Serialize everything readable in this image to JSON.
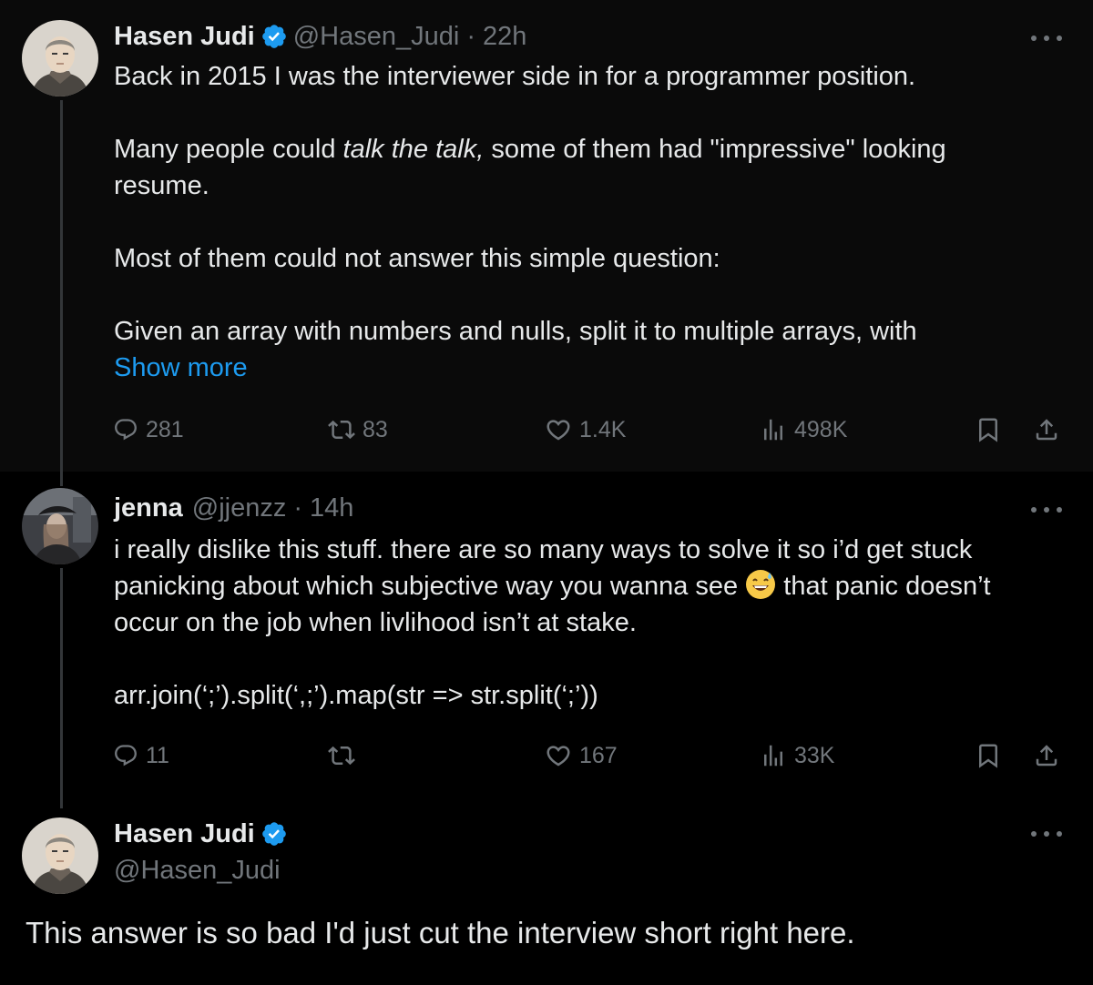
{
  "colors": {
    "background": "#000000",
    "text": "#e7e9ea",
    "muted": "#71767b",
    "link": "#1d9bf0",
    "verified": "#1d9bf0"
  },
  "tweets": [
    {
      "author": "Hasen Judi",
      "handle": "@Hasen_Judi",
      "separator": "·",
      "time": "22h",
      "verified": true,
      "lines": [
        "Back in 2015 I was the interviewer side in for a programmer position.",
        "",
        "Many people could",
        "talk the talk,",
        "some of them had \"impressive\" looking",
        "resume.",
        "",
        "Most of them could not answer this simple question:",
        "",
        "Given an array with numbers and nulls, split it to multiple arrays, with"
      ],
      "show_more": "Show more",
      "stats": {
        "replies": "281",
        "reposts": "83",
        "likes": "1.4K",
        "views": "498K"
      }
    },
    {
      "author": "jenna",
      "handle": "@jjenzz",
      "separator": "·",
      "time": "14h",
      "verified": false,
      "lines": [
        "i really dislike this stuff. there are so many ways to solve it so i’d get stuck",
        "panicking about which subjective way you wanna see",
        "that panic doesn’t",
        "occur on the job when livlihood isn’t at stake.",
        "",
        "arr.join(‘;’).split(‘,;’).map(str => str.split(‘;’))"
      ],
      "emoji": "grinning-face-with-sweat-emoji",
      "stats": {
        "replies": "11",
        "reposts": "",
        "likes": "167",
        "views": "33K"
      }
    },
    {
      "author": "Hasen Judi",
      "handle": "@Hasen_Judi",
      "verified": true,
      "text": "This answer is so bad I'd just cut the interview short right here."
    }
  ],
  "icons": {
    "reply": "reply-icon",
    "repost": "repost-icon",
    "like": "heart-icon",
    "views": "views-icon",
    "bookmark": "bookmark-icon",
    "share": "share-icon",
    "more": "more-icon",
    "verified": "verified-badge-icon"
  }
}
